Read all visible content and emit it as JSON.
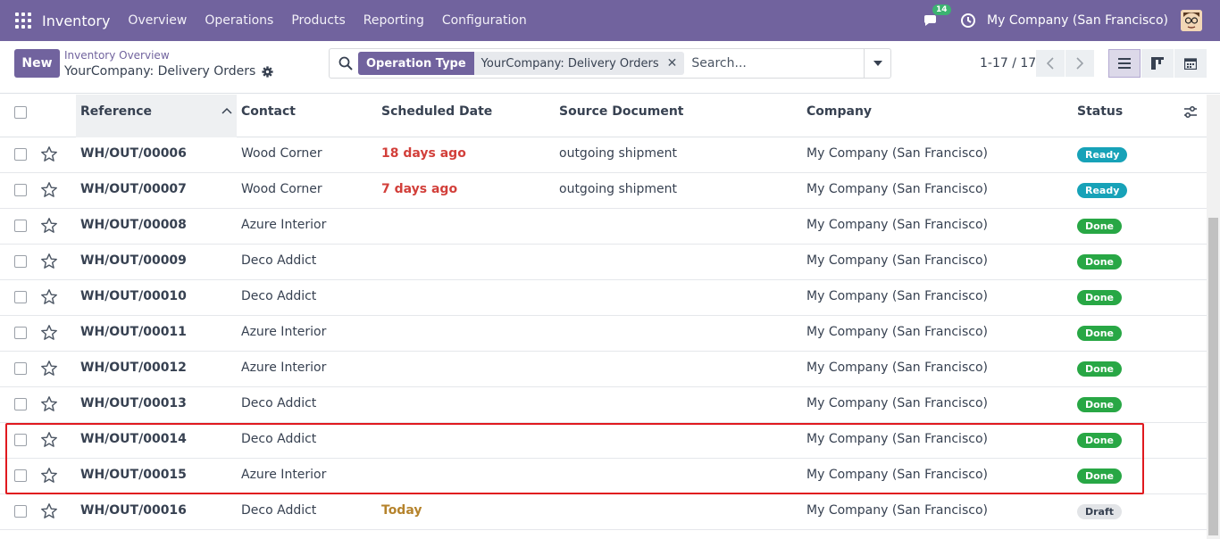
{
  "topbar": {
    "app_name": "Inventory",
    "menu": [
      "Overview",
      "Operations",
      "Products",
      "Reporting",
      "Configuration"
    ],
    "chat_count": "14",
    "company": "My Company (San Francisco)"
  },
  "control": {
    "new_label": "New",
    "breadcrumb": "Inventory Overview",
    "title": "YourCompany: Delivery Orders",
    "facet_label": "Operation Type",
    "facet_value": "YourCompany: Delivery Orders",
    "search_placeholder": "Search...",
    "pager": "1-17 / 17"
  },
  "columns": {
    "reference": "Reference",
    "contact": "Contact",
    "scheduled_date": "Scheduled Date",
    "source_document": "Source Document",
    "company": "Company",
    "status": "Status"
  },
  "rows": [
    {
      "ref": "WH/OUT/00006",
      "contact": "Wood Corner",
      "date": "18 days ago",
      "date_kind": "late",
      "source": "outgoing shipment",
      "company": "My Company (San Francisco)",
      "status": "Ready",
      "status_kind": "ready"
    },
    {
      "ref": "WH/OUT/00007",
      "contact": "Wood Corner",
      "date": "7 days ago",
      "date_kind": "late",
      "source": "outgoing shipment",
      "company": "My Company (San Francisco)",
      "status": "Ready",
      "status_kind": "ready"
    },
    {
      "ref": "WH/OUT/00008",
      "contact": "Azure Interior",
      "date": "",
      "date_kind": "",
      "source": "",
      "company": "My Company (San Francisco)",
      "status": "Done",
      "status_kind": "done"
    },
    {
      "ref": "WH/OUT/00009",
      "contact": "Deco Addict",
      "date": "",
      "date_kind": "",
      "source": "",
      "company": "My Company (San Francisco)",
      "status": "Done",
      "status_kind": "done"
    },
    {
      "ref": "WH/OUT/00010",
      "contact": "Deco Addict",
      "date": "",
      "date_kind": "",
      "source": "",
      "company": "My Company (San Francisco)",
      "status": "Done",
      "status_kind": "done"
    },
    {
      "ref": "WH/OUT/00011",
      "contact": "Azure Interior",
      "date": "",
      "date_kind": "",
      "source": "",
      "company": "My Company (San Francisco)",
      "status": "Done",
      "status_kind": "done"
    },
    {
      "ref": "WH/OUT/00012",
      "contact": "Azure Interior",
      "date": "",
      "date_kind": "",
      "source": "",
      "company": "My Company (San Francisco)",
      "status": "Done",
      "status_kind": "done"
    },
    {
      "ref": "WH/OUT/00013",
      "contact": "Deco Addict",
      "date": "",
      "date_kind": "",
      "source": "",
      "company": "My Company (San Francisco)",
      "status": "Done",
      "status_kind": "done"
    },
    {
      "ref": "WH/OUT/00014",
      "contact": "Deco Addict",
      "date": "",
      "date_kind": "",
      "source": "",
      "company": "My Company (San Francisco)",
      "status": "Done",
      "status_kind": "done"
    },
    {
      "ref": "WH/OUT/00015",
      "contact": "Azure Interior",
      "date": "",
      "date_kind": "",
      "source": "",
      "company": "My Company (San Francisco)",
      "status": "Done",
      "status_kind": "done"
    },
    {
      "ref": "WH/OUT/00016",
      "contact": "Deco Addict",
      "date": "Today",
      "date_kind": "today",
      "source": "",
      "company": "My Company (San Francisco)",
      "status": "Draft",
      "status_kind": "draft"
    }
  ],
  "colors": {
    "brand": "#71639e",
    "late": "#d23f3a",
    "today": "#b5832c",
    "ready": "#17a2b8",
    "done": "#28a745",
    "highlight": "#e0191f"
  }
}
